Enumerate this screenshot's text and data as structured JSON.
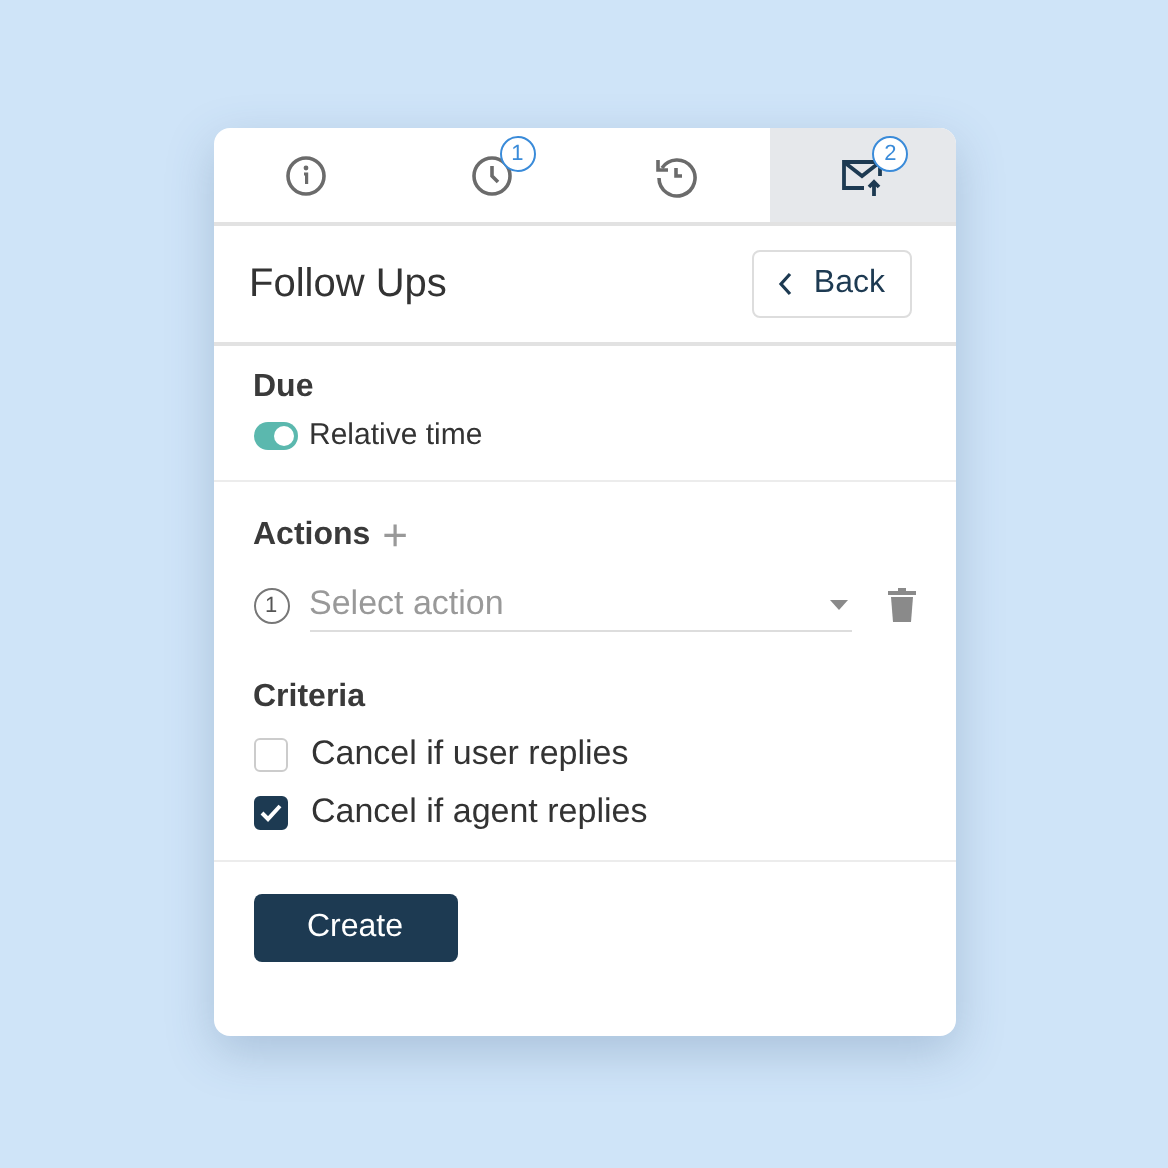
{
  "tabs": [
    {
      "kind": "info",
      "selected": false
    },
    {
      "kind": "clock",
      "badge": "1",
      "selected": false
    },
    {
      "kind": "history",
      "selected": false
    },
    {
      "kind": "mail",
      "badge": "2",
      "selected": true
    }
  ],
  "header": {
    "title": "Follow Ups",
    "back": "Back"
  },
  "due": {
    "heading": "Due",
    "toggle": {
      "label": "Relative time",
      "on": true
    }
  },
  "actions": {
    "heading": "Actions",
    "add": "+",
    "items": [
      {
        "number": "1",
        "placeholder": "Select action"
      }
    ]
  },
  "criteria": {
    "heading": "Criteria",
    "options": [
      {
        "label": "Cancel if user replies",
        "checked": false
      },
      {
        "label": "Cancel if agent replies",
        "checked": true
      }
    ]
  },
  "submit": "Create"
}
